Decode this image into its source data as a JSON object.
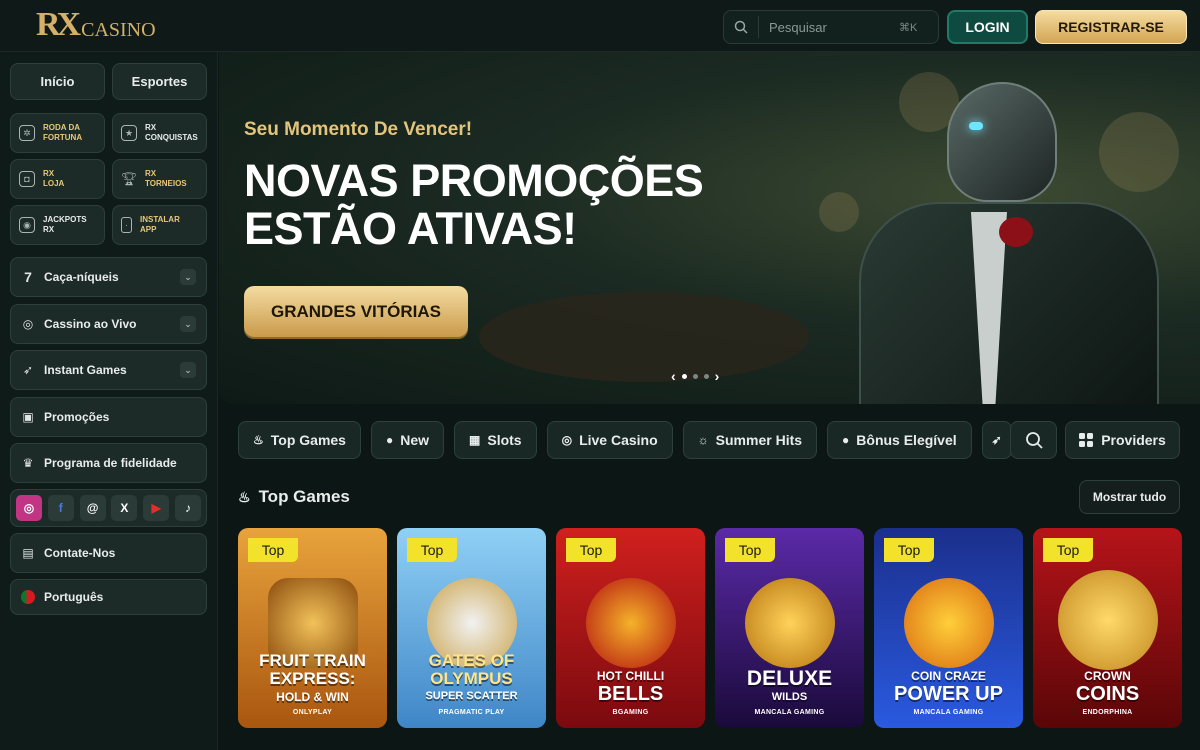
{
  "header": {
    "logo_rx": "RX",
    "logo_casino": "CASINO",
    "search_placeholder": "Pesquisar",
    "search_shortcut": "⌘K",
    "login_label": "LOGIN",
    "register_label": "REGISTRAR-SE"
  },
  "sidebar": {
    "tabs": [
      "Início",
      "Esportes"
    ],
    "tiles": [
      {
        "label": "RODA DA\nFORTUNA",
        "icon": "wheel-icon",
        "accent": true
      },
      {
        "label": "RX\nCONQUISTAS",
        "icon": "trophy-badge-icon",
        "accent": false
      },
      {
        "label": "RX\nLOJA",
        "icon": "shopping-bag-icon",
        "accent": true
      },
      {
        "label": "RX\nTORNEIOS",
        "icon": "cup-icon",
        "accent": true
      },
      {
        "label": "JACKPOTS\nRX",
        "icon": "jackpot-icon",
        "accent": false
      },
      {
        "label": "INSTALAR\nAPP",
        "icon": "phone-icon",
        "accent": true
      }
    ],
    "menu": [
      {
        "label": "Caça-níqueis",
        "icon": "seven-icon",
        "chevron": true
      },
      {
        "label": "Cassino ao Vivo",
        "icon": "chip-icon",
        "chevron": true
      },
      {
        "label": "Instant Games",
        "icon": "rocket-icon",
        "chevron": true
      },
      {
        "label": "Promoções",
        "icon": "gift-icon",
        "chevron": false
      },
      {
        "label": "Programa de fidelidade",
        "icon": "crown-icon",
        "chevron": false
      }
    ],
    "socials": [
      "instagram-icon",
      "facebook-icon",
      "threads-icon",
      "x-icon",
      "youtube-icon",
      "tiktok-icon"
    ],
    "contact_label": "Contate-Nos",
    "language_label": "Português"
  },
  "banner": {
    "kicker": "Seu Momento De Vencer!",
    "title": "NOVAS PROMOÇÕES ESTÃO ATIVAS!",
    "cta": "GRANDES VITÓRIAS",
    "slides_total": 3,
    "slide_active": 1
  },
  "categories": [
    {
      "label": "Top Games",
      "icon": "flame-icon"
    },
    {
      "label": "New",
      "icon": "new-icon"
    },
    {
      "label": "Slots",
      "icon": "slots-icon"
    },
    {
      "label": "Live Casino",
      "icon": "chip-icon"
    },
    {
      "label": "Summer Hits",
      "icon": "sun-icon"
    },
    {
      "label": "Bônus Elegível",
      "icon": "bonus-icon"
    },
    {
      "label": "",
      "icon": "rocket-icon"
    }
  ],
  "providers_label": "Providers",
  "section": {
    "title": "Top Games",
    "show_all": "Mostrar tudo"
  },
  "games": [
    {
      "badge": "Top",
      "title": "FRUIT TRAIN EXPRESS:",
      "subtitle": "HOLD & WIN",
      "provider": "ONLYPLAY",
      "bg": "#c8781e"
    },
    {
      "badge": "Top",
      "title": "GATES OF OLYMPUS",
      "subtitle": "SUPER SCATTER",
      "provider": "PRAGMATIC PLAY",
      "bg": "#6fb5e8"
    },
    {
      "badge": "Top",
      "title": "HOT CHILLI",
      "subtitle": "BELLS",
      "provider": "BGAMING",
      "bg": "#a3121a"
    },
    {
      "badge": "Top",
      "title": "DELUXE",
      "subtitle": "WILDS",
      "provider": "MANCALA GAMING",
      "bg": "#3a1a6a"
    },
    {
      "badge": "Top",
      "title": "COIN CRAZE",
      "subtitle": "POWER UP",
      "provider": "MANCALA GAMING",
      "bg": "#1f3fb0"
    },
    {
      "badge": "Top",
      "title": "CROWN",
      "subtitle": "COINS",
      "provider": "ENDORPHINA",
      "bg": "#8f0f12"
    }
  ]
}
